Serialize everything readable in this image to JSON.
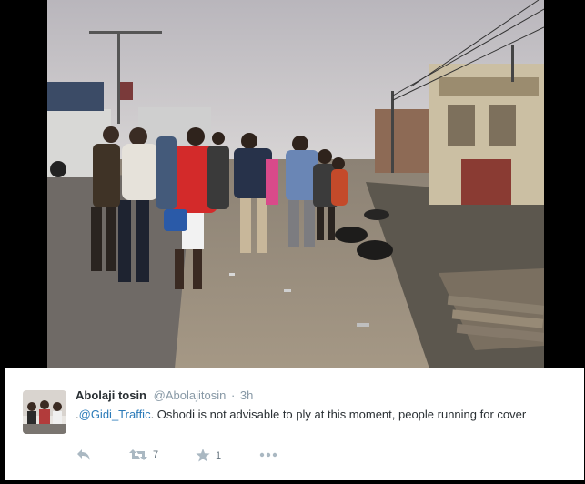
{
  "tweet": {
    "author_name": "Abolaji tosin",
    "author_handle": "@Abolajitosin",
    "separator": "·",
    "timestamp": "3h",
    "text_prefix": ".",
    "mention": "@Gidi_Traffic",
    "text_body": ". Oshodi is not advisable to ply at this moment, people running for cover",
    "media_description": "photo",
    "colors": {
      "link": "#2b7bb9",
      "name": "#292f33",
      "meta": "#8899a6",
      "icon": "#aab8c2"
    }
  },
  "actions": {
    "reply": {
      "icon": "reply-icon",
      "count": ""
    },
    "retweet": {
      "icon": "retweet-icon",
      "count": "7"
    },
    "favorite": {
      "icon": "star-icon",
      "count": "1"
    },
    "more": {
      "icon": "more-icon"
    }
  }
}
